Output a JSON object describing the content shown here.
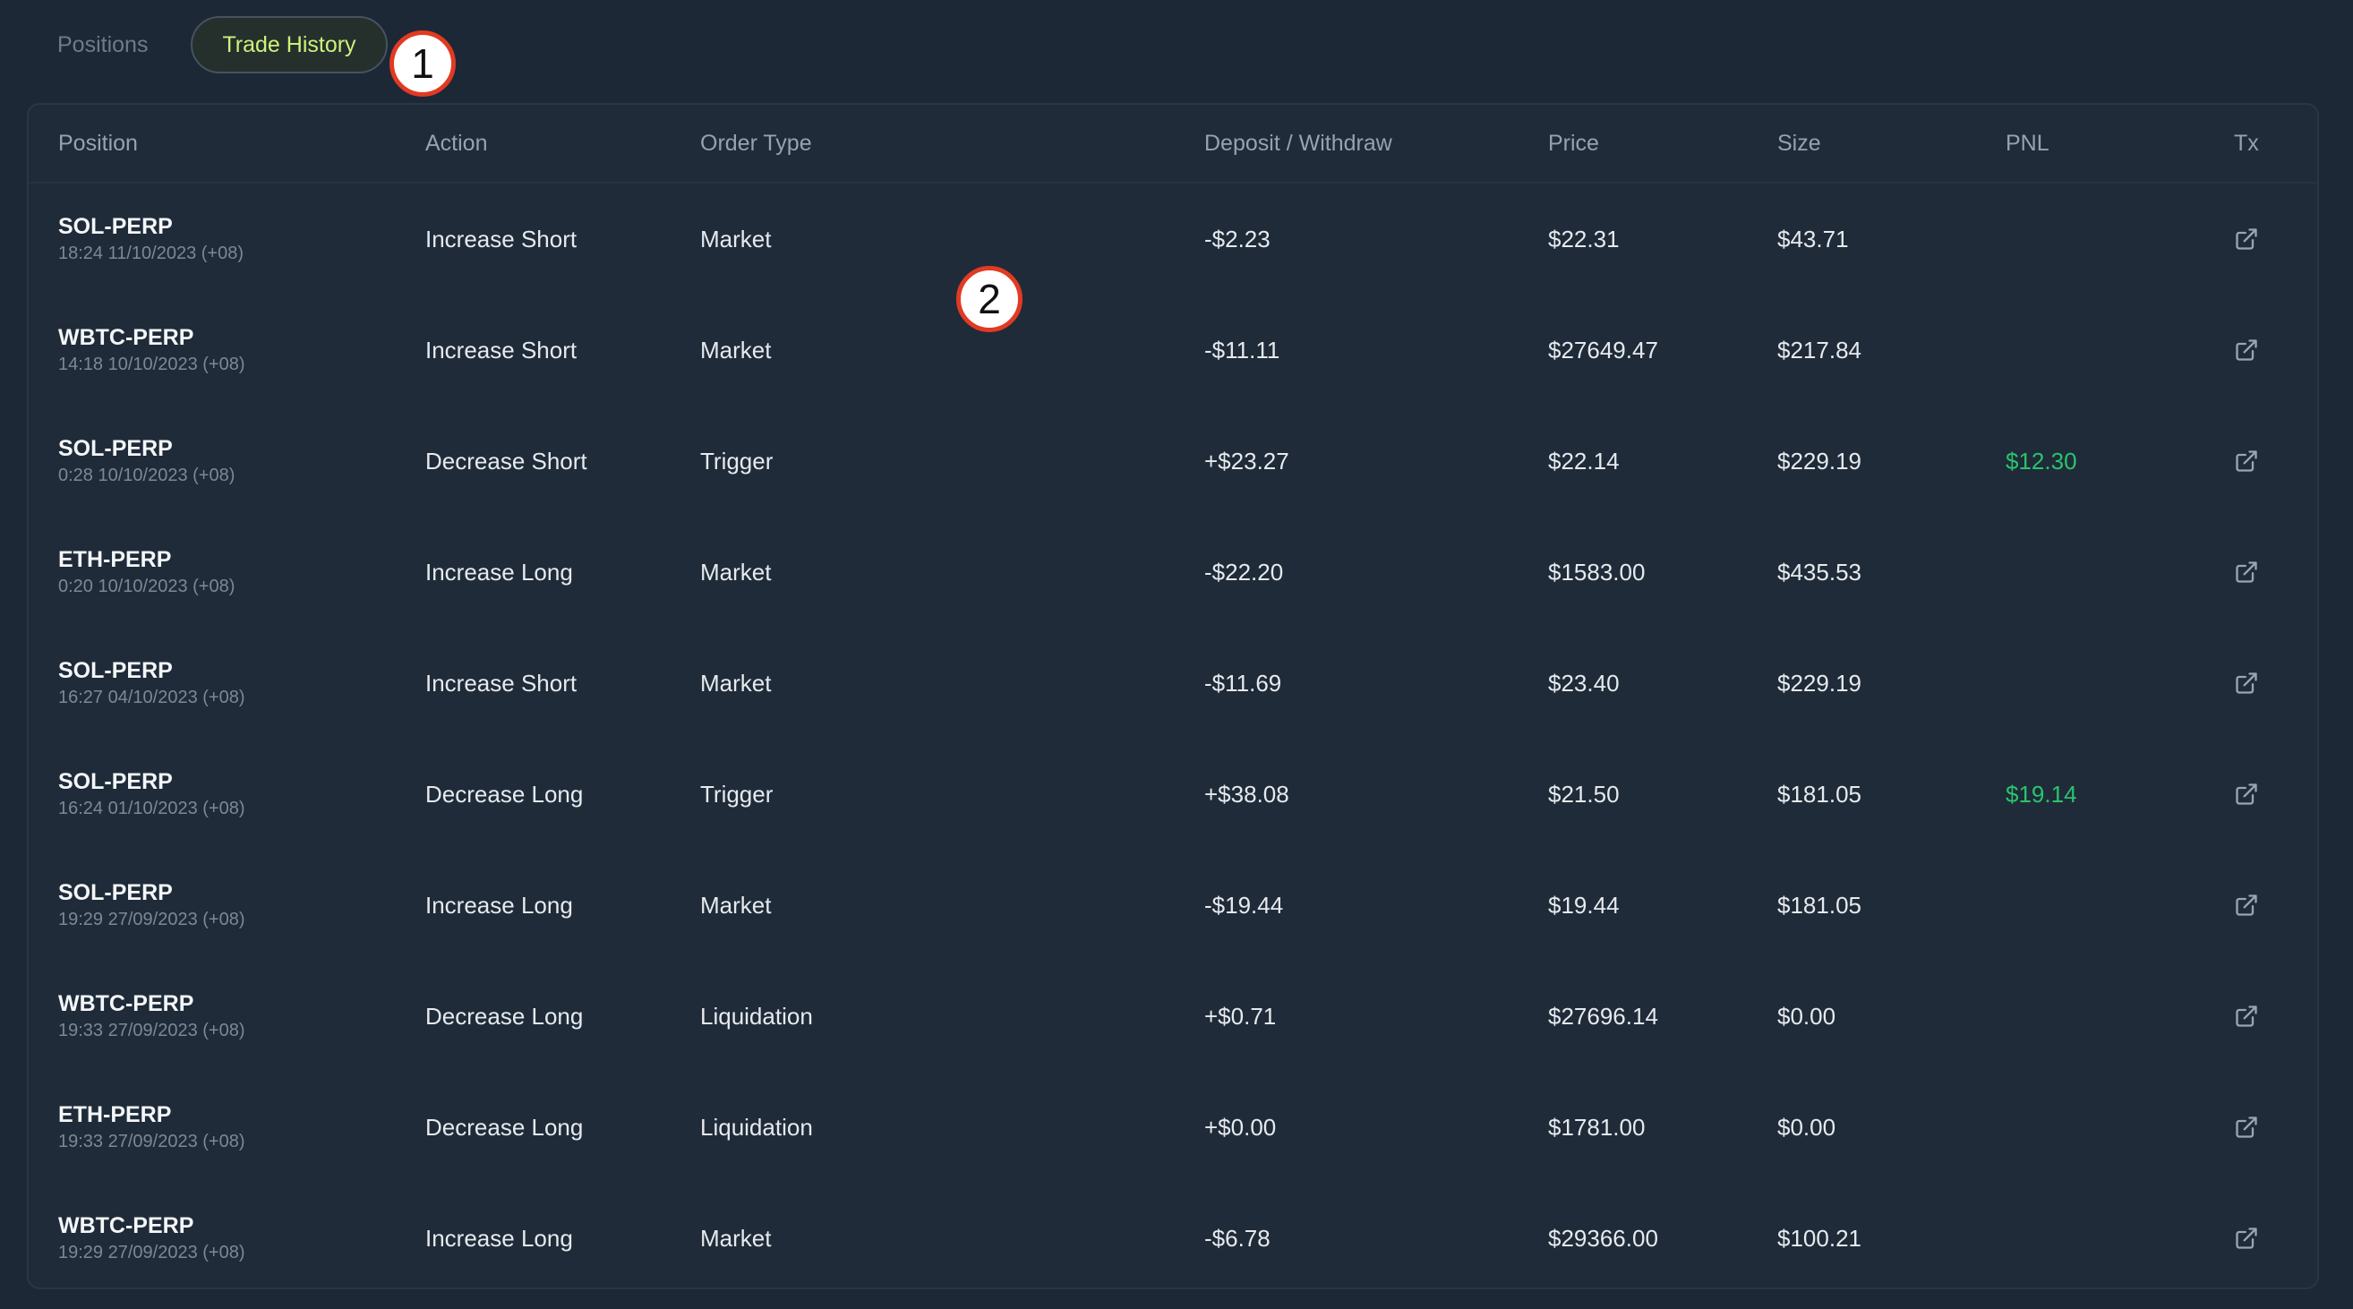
{
  "tabs": [
    {
      "label": "Positions",
      "active": false
    },
    {
      "label": "Trade History",
      "active": true
    }
  ],
  "markers": [
    "1",
    "2"
  ],
  "table": {
    "headers": {
      "position": "Position",
      "action": "Action",
      "order_type": "Order Type",
      "deposit": "Deposit / Withdraw",
      "price": "Price",
      "size": "Size",
      "pnl": "PNL",
      "tx": "Tx"
    },
    "rows": [
      {
        "symbol": "SOL-PERP",
        "time": "18:24 11/10/2023 (+08)",
        "action": "Increase Short",
        "order_type": "Market",
        "deposit": "-$2.23",
        "price": "$22.31",
        "size": "$43.71",
        "pnl": ""
      },
      {
        "symbol": "WBTC-PERP",
        "time": "14:18 10/10/2023 (+08)",
        "action": "Increase Short",
        "order_type": "Market",
        "deposit": "-$11.11",
        "price": "$27649.47",
        "size": "$217.84",
        "pnl": ""
      },
      {
        "symbol": "SOL-PERP",
        "time": "0:28 10/10/2023 (+08)",
        "action": "Decrease Short",
        "order_type": "Trigger",
        "deposit": "+$23.27",
        "price": "$22.14",
        "size": "$229.19",
        "pnl": "$12.30"
      },
      {
        "symbol": "ETH-PERP",
        "time": "0:20 10/10/2023 (+08)",
        "action": "Increase Long",
        "order_type": "Market",
        "deposit": "-$22.20",
        "price": "$1583.00",
        "size": "$435.53",
        "pnl": ""
      },
      {
        "symbol": "SOL-PERP",
        "time": "16:27 04/10/2023 (+08)",
        "action": "Increase Short",
        "order_type": "Market",
        "deposit": "-$11.69",
        "price": "$23.40",
        "size": "$229.19",
        "pnl": ""
      },
      {
        "symbol": "SOL-PERP",
        "time": "16:24 01/10/2023 (+08)",
        "action": "Decrease Long",
        "order_type": "Trigger",
        "deposit": "+$38.08",
        "price": "$21.50",
        "size": "$181.05",
        "pnl": "$19.14"
      },
      {
        "symbol": "SOL-PERP",
        "time": "19:29 27/09/2023 (+08)",
        "action": "Increase Long",
        "order_type": "Market",
        "deposit": "-$19.44",
        "price": "$19.44",
        "size": "$181.05",
        "pnl": ""
      },
      {
        "symbol": "WBTC-PERP",
        "time": "19:33 27/09/2023 (+08)",
        "action": "Decrease Long",
        "order_type": "Liquidation",
        "deposit": "+$0.71",
        "price": "$27696.14",
        "size": "$0.00",
        "pnl": ""
      },
      {
        "symbol": "ETH-PERP",
        "time": "19:33 27/09/2023 (+08)",
        "action": "Decrease Long",
        "order_type": "Liquidation",
        "deposit": "+$0.00",
        "price": "$1781.00",
        "size": "$0.00",
        "pnl": ""
      },
      {
        "symbol": "WBTC-PERP",
        "time": "19:29 27/09/2023 (+08)",
        "action": "Increase Long",
        "order_type": "Market",
        "deposit": "-$6.78",
        "price": "$29366.00",
        "size": "$100.21",
        "pnl": ""
      }
    ],
    "tx_icon": "external-link-icon"
  },
  "colors": {
    "background": "#1c2836",
    "active_tab_text": "#cdf27a",
    "pnl_positive": "#29c46c",
    "marker_border": "#e23a22"
  }
}
